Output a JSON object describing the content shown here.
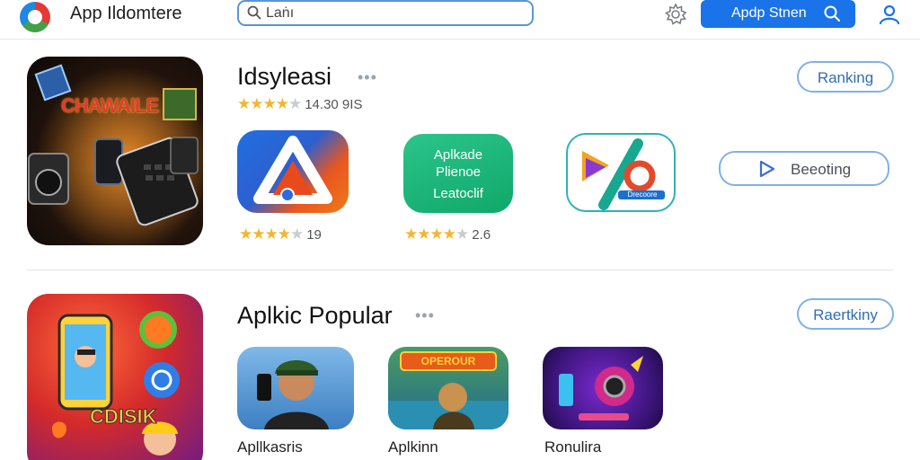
{
  "header": {
    "app_title": "App Ildomtere",
    "search_value": "Laṅı",
    "store_button_label": "Apdp Stnen",
    "icons": [
      "app-logo-icon",
      "search-icon",
      "gear-icon",
      "profile-icon"
    ]
  },
  "section1": {
    "title": "Idsyleasi",
    "more": "•••",
    "rating_text": "14.30 9IS",
    "ranking_label": "Ranking",
    "banner_text": "CHAWAILE",
    "apps": [
      {
        "rating_text": "19"
      },
      {
        "line1": "Aplkade",
        "line2": "Plienoe",
        "line3": "Leatoclif",
        "rating_text": "2.6"
      },
      {
        "badge": "Drecoore"
      }
    ],
    "action_label": "Beeoting"
  },
  "section2": {
    "title": "Aplkic Popular",
    "more": "•••",
    "ranking_label": "Raertkiny",
    "banner_text": "CDISIK",
    "apps": [
      {
        "caption": "Apllkasris"
      },
      {
        "caption": "Aplkinn",
        "title_text": "OPEROUR"
      },
      {
        "caption": "Ronulira"
      }
    ]
  },
  "colors": {
    "accent": "#1a73e8",
    "pill_border": "#7fb2e5",
    "star": "#f2b630"
  }
}
